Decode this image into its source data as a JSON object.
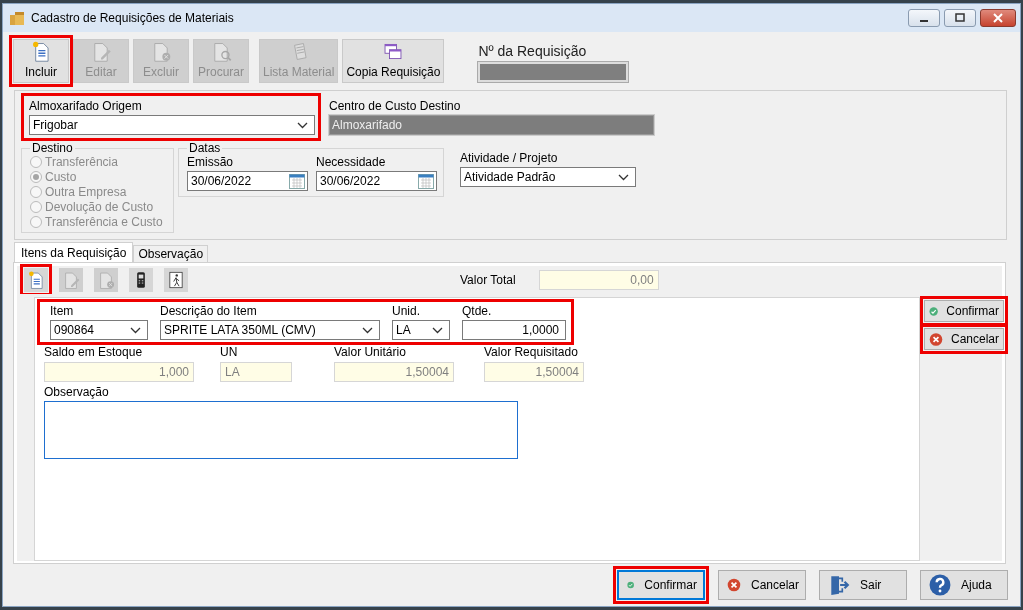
{
  "window": {
    "title": "Cadastro de Requisições de Materiais"
  },
  "toolbar": [
    {
      "label": "Incluir",
      "kind": "new",
      "disabled": false,
      "highlighted": true
    },
    {
      "label": "Editar",
      "kind": "edit",
      "disabled": true,
      "highlighted": false
    },
    {
      "label": "Excluir",
      "kind": "delete",
      "disabled": true,
      "highlighted": false
    },
    {
      "label": "Procurar",
      "kind": "search",
      "disabled": true,
      "highlighted": false
    },
    {
      "label": "Lista Material",
      "kind": "list",
      "disabled": true,
      "highlighted": false
    },
    {
      "label": "Copia Requisição",
      "kind": "copy",
      "disabled": false,
      "highlighted": false
    }
  ],
  "requisition_number": {
    "label": "Nº da Requisição"
  },
  "origin": {
    "label": "Almoxarifado Origem",
    "value": "Frigobar",
    "highlighted": true
  },
  "cost_center": {
    "label": "Centro de Custo Destino",
    "value": "Almoxarifado"
  },
  "destino": {
    "label": "Destino",
    "disabled": true,
    "options": [
      {
        "label": "Transferência",
        "selected": false
      },
      {
        "label": "Custo",
        "selected": true
      },
      {
        "label": "Outra Empresa",
        "selected": false
      },
      {
        "label": "Devolução de Custo",
        "selected": false
      },
      {
        "label": "Transferência e Custo",
        "selected": false
      }
    ]
  },
  "datas": {
    "label": "Datas",
    "fields": [
      {
        "label": "Emissão",
        "value": "30/06/2022"
      },
      {
        "label": "Necessidade",
        "value": "30/06/2022"
      }
    ]
  },
  "activity": {
    "label": "Atividade / Projeto",
    "value": "Atividade Padrão"
  },
  "tabs": [
    {
      "label": "Itens da Requisição",
      "selected": true
    },
    {
      "label": "Observação",
      "selected": false
    }
  ],
  "item_toolbar": [
    {
      "kind": "new",
      "disabled": false,
      "highlighted": true
    },
    {
      "kind": "edit",
      "disabled": true,
      "highlighted": false
    },
    {
      "kind": "delete",
      "disabled": true,
      "highlighted": false
    },
    {
      "kind": "scanner",
      "disabled": false,
      "highlighted": false
    },
    {
      "kind": "walker",
      "disabled": false,
      "highlighted": false
    }
  ],
  "total": {
    "label": "Valor Total",
    "value": "0,00"
  },
  "item_entry": {
    "highlighted": true,
    "fields": [
      {
        "label": "Item",
        "value": "090864",
        "kind": "combo"
      },
      {
        "label": "Descrição do Item",
        "value": "SPRITE LATA 350ML (CMV)",
        "kind": "combo"
      },
      {
        "label": "Unid.",
        "value": "LA",
        "kind": "combo"
      },
      {
        "label": "Qtde.",
        "value": "1,0000",
        "kind": "number"
      }
    ]
  },
  "info_fields": [
    {
      "label": "Saldo em Estoque",
      "value": "1,000",
      "kind": "number"
    },
    {
      "label": "UN",
      "value": "LA",
      "kind": "text"
    },
    {
      "label": "Valor Unitário",
      "value": "1,50004",
      "kind": "number"
    },
    {
      "label": "Valor Requisitado",
      "value": "1,50004",
      "kind": "number"
    }
  ],
  "observation": {
    "label": "Observação"
  },
  "side_buttons": [
    {
      "label": "Confirmar",
      "kind": "confirm",
      "highlighted": true,
      "focused": false
    },
    {
      "label": "Cancelar",
      "kind": "cancel",
      "highlighted": true,
      "focused": false
    }
  ],
  "footer_buttons": [
    {
      "label": "Confirmar",
      "kind": "confirm",
      "highlighted": true,
      "focused": true
    },
    {
      "label": "Cancelar",
      "kind": "cancel",
      "highlighted": false,
      "focused": false
    },
    {
      "label": "Sair",
      "kind": "exit",
      "highlighted": false,
      "focused": false
    },
    {
      "label": "Ajuda",
      "kind": "help",
      "highlighted": false,
      "focused": false
    }
  ]
}
